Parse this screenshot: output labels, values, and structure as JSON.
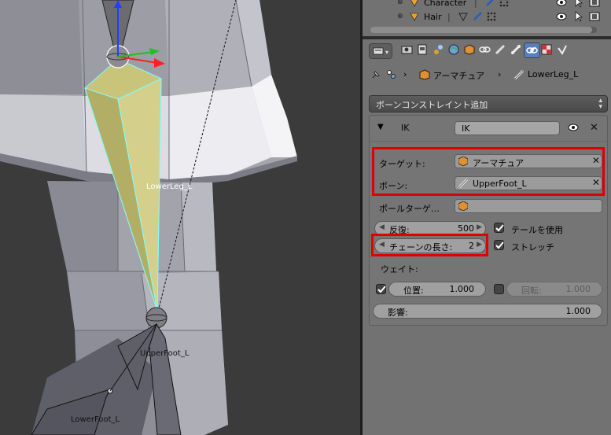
{
  "outliner": {
    "rows": [
      {
        "name": "Character"
      },
      {
        "name": "Hair"
      }
    ],
    "separator": "|"
  },
  "breadcrumb": {
    "armature": "アーマチュア",
    "bone": "LowerLeg_L",
    "arrow": "›"
  },
  "viewport": {
    "labels": {
      "lower_leg": "LowerLeg_L",
      "upper_foot": "UpperFoot_L",
      "lower_foot": "LowerFoot_L"
    }
  },
  "add_constraint": {
    "label": "ボーンコンストレイント追加"
  },
  "constraint": {
    "type_label": "IK",
    "name_value": "IK",
    "target_label": "ターゲット:",
    "target_value": "アーマチュア",
    "bone_label": "ボーン:",
    "bone_value": "UpperFoot_L",
    "pole_label": "ポールターゲ…",
    "iterations_label": "反復:",
    "iterations_value": "500",
    "use_tail_label": "テールを使用",
    "chain_label": "チェーンの長さ:",
    "chain_value": "2",
    "stretch_label": "ストレッチ",
    "weight_label": "ウェイト:",
    "position_label": "位置:",
    "position_value": "1.000",
    "rotation_label": "回転:",
    "rotation_value": "1.000",
    "influence_label": "影響:",
    "influence_value": "1.000",
    "use_tail_checked": true,
    "stretch_checked": true,
    "position_checked": true,
    "rotation_checked": false
  },
  "colors": {
    "highlight_box": "#e00000",
    "bone_selected": "#c8c47a",
    "bone_outline": "#7fffff",
    "panel_bg": "#727272"
  },
  "icons": [
    "pin-icon",
    "armature-object-icon",
    "bone-icon",
    "eye-icon",
    "close-icon",
    "cube-icon",
    "camera-icon",
    "world-icon"
  ]
}
